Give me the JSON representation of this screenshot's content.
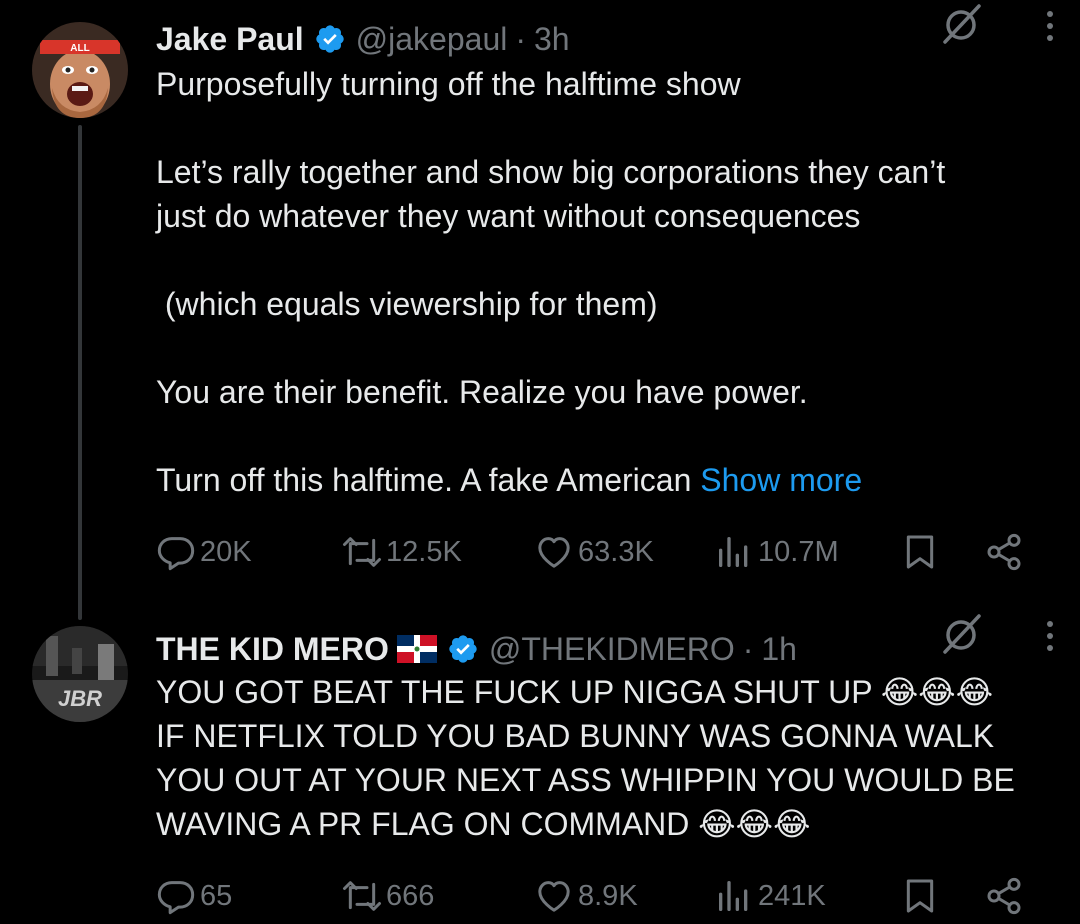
{
  "colors": {
    "background": "#000000",
    "text": "#e7e9ea",
    "muted": "#71767b",
    "link": "#1d9bf0",
    "verified": "#1d9bf0",
    "thread_line": "#333639"
  },
  "tweets": [
    {
      "author_name": "Jake Paul",
      "handle": "@jakepaul",
      "separator": "·",
      "time": "3h",
      "lines": [
        "Purposefully turning off the halftime show",
        "",
        "Let’s rally together and show big corporations they can’t",
        "just do whatever they want without consequences",
        "",
        " (which equals viewership for them)",
        "",
        "You are their benefit. Realize you have power.",
        "",
        "Turn off this halftime. A fake American "
      ],
      "show_more": "Show more",
      "actions": {
        "replies": "20K",
        "reposts": "12.5K",
        "likes": "63.3K",
        "views": "10.7M"
      },
      "icons": [
        "verified-icon",
        "grok-icon",
        "more-icon",
        "reply-icon",
        "repost-icon",
        "like-icon",
        "views-icon",
        "bookmark-icon",
        "share-icon"
      ]
    },
    {
      "author_name": "THE KID MERO",
      "handle": "@THEKIDMERO",
      "separator": "·",
      "time": "1h",
      "lines": [
        "YOU GOT BEAT THE FUCK UP NIGGA SHUT UP",
        "IF NETFLIX TOLD YOU BAD BUNNY WAS GONNA WALK",
        "YOU OUT AT YOUR NEXT ASS WHIPPIN YOU WOULD BE",
        "WAVING A PR FLAG ON COMMAND"
      ],
      "emoji": "😂",
      "actions": {
        "replies": "65",
        "reposts": "666",
        "likes": "8.9K",
        "views": "241K"
      },
      "icons": [
        "dominican-flag-icon",
        "verified-icon",
        "grok-icon",
        "more-icon",
        "reply-icon",
        "repost-icon",
        "like-icon",
        "views-icon",
        "bookmark-icon",
        "share-icon"
      ]
    }
  ]
}
